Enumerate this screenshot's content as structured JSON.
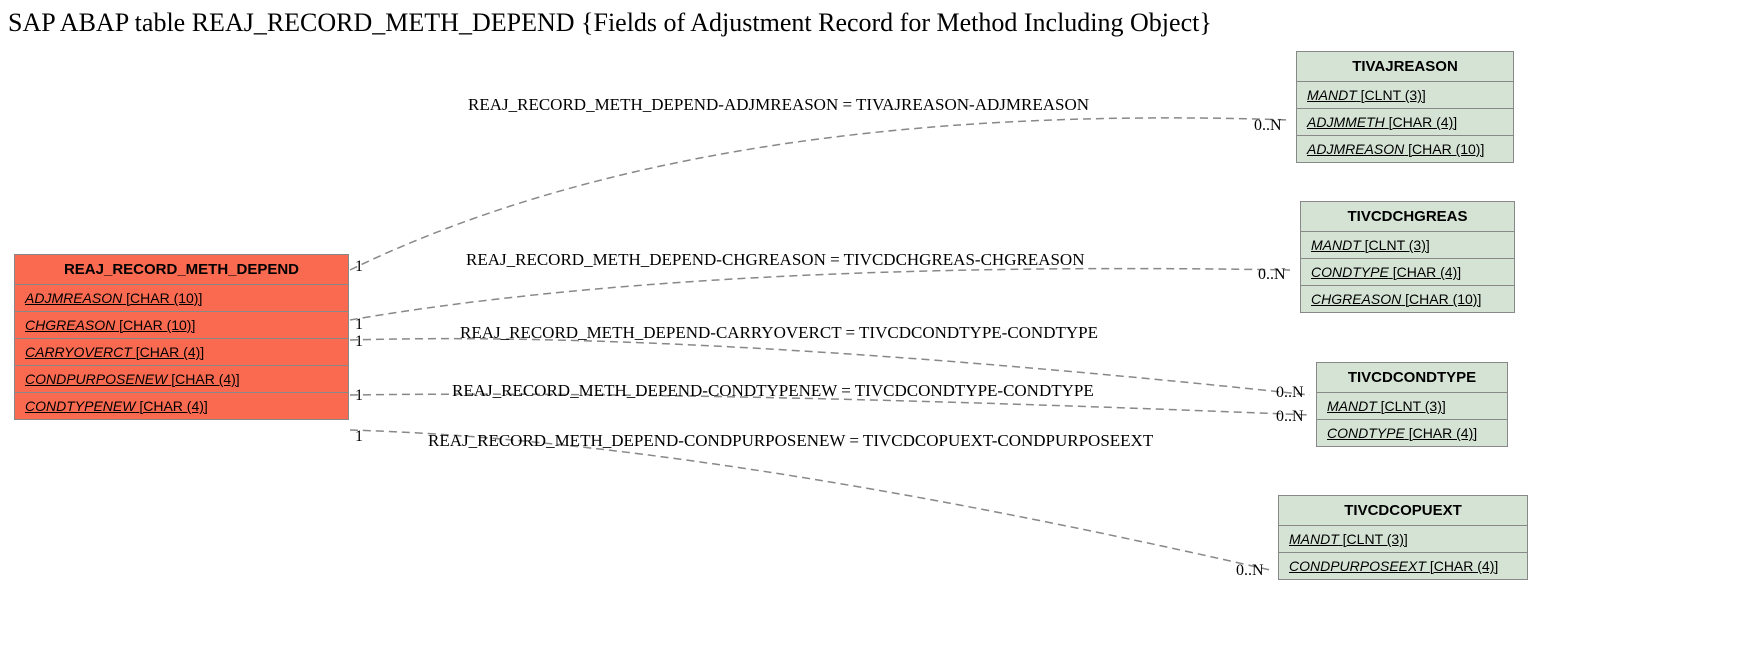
{
  "title": "SAP ABAP table REAJ_RECORD_METH_DEPEND {Fields of Adjustment Record for Method Including Object}",
  "main_entity": {
    "name": "REAJ_RECORD_METH_DEPEND",
    "fields": [
      {
        "name": "ADJMREASON",
        "type": "[CHAR (10)]"
      },
      {
        "name": "CHGREASON",
        "type": "[CHAR (10)]"
      },
      {
        "name": "CARRYOVERCT",
        "type": "[CHAR (4)]"
      },
      {
        "name": "CONDPURPOSENEW",
        "type": "[CHAR (4)]"
      },
      {
        "name": "CONDTYPENEW",
        "type": "[CHAR (4)]"
      }
    ]
  },
  "ref_entities": [
    {
      "name": "TIVAJREASON",
      "fields": [
        {
          "name": "MANDT",
          "type": "[CLNT (3)]"
        },
        {
          "name": "ADJMMETH",
          "type": "[CHAR (4)]"
        },
        {
          "name": "ADJMREASON",
          "type": "[CHAR (10)]"
        }
      ]
    },
    {
      "name": "TIVCDCHGREAS",
      "fields": [
        {
          "name": "MANDT",
          "type": "[CLNT (3)]"
        },
        {
          "name": "CONDTYPE",
          "type": "[CHAR (4)]"
        },
        {
          "name": "CHGREASON",
          "type": "[CHAR (10)]"
        }
      ]
    },
    {
      "name": "TIVCDCONDTYPE",
      "fields": [
        {
          "name": "MANDT",
          "type": "[CLNT (3)]"
        },
        {
          "name": "CONDTYPE",
          "type": "[CHAR (4)]"
        }
      ]
    },
    {
      "name": "TIVCDCOPUEXT",
      "fields": [
        {
          "name": "MANDT",
          "type": "[CLNT (3)]"
        },
        {
          "name": "CONDPURPOSEEXT",
          "type": "[CHAR (4)]"
        }
      ]
    }
  ],
  "relations": [
    {
      "label": "REAJ_RECORD_METH_DEPEND-ADJMREASON = TIVAJREASON-ADJMREASON",
      "left_card": "1",
      "right_card": "0..N"
    },
    {
      "label": "REAJ_RECORD_METH_DEPEND-CHGREASON = TIVCDCHGREAS-CHGREASON",
      "left_card": "1",
      "right_card": "0..N"
    },
    {
      "label": "REAJ_RECORD_METH_DEPEND-CARRYOVERCT = TIVCDCONDTYPE-CONDTYPE",
      "left_card": "1",
      "right_card": "0..N"
    },
    {
      "label": "REAJ_RECORD_METH_DEPEND-CONDTYPENEW = TIVCDCONDTYPE-CONDTYPE",
      "left_card": "1",
      "right_card": "0..N"
    },
    {
      "label": "REAJ_RECORD_METH_DEPEND-CONDPURPOSENEW = TIVCDCOPUEXT-CONDPURPOSEEXT",
      "left_card": "1",
      "right_card": "0..N"
    }
  ]
}
